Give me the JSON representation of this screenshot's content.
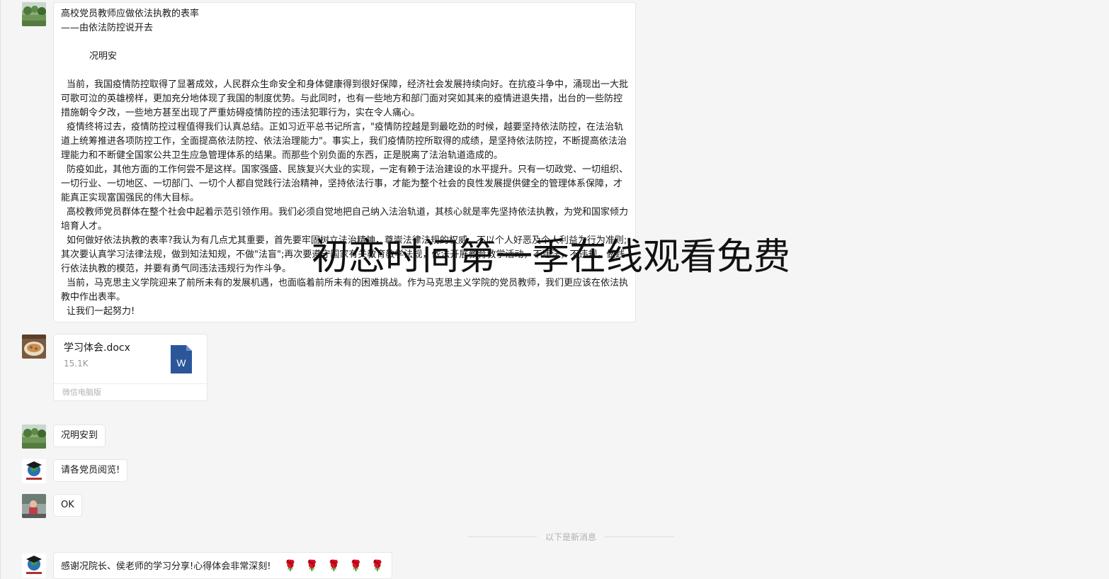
{
  "messages": {
    "article": {
      "title": "高校党员教师应做依法执教的表率",
      "subtitle": "——由依法防控说开去",
      "author": "况明安",
      "paragraphs": [
        "当前，我国疫情防控取得了显著成效，人民群众生命安全和身体健康得到很好保障，经济社会发展持续向好。在抗疫斗争中，涌现出一大批可歌可泣的英雄榜样，更加充分地体现了我国的制度优势。与此同时，也有一些地方和部门面对突如其来的疫情进退失措，出台的一些防控措施朝令夕改，一些地方甚至出现了严重妨碍疫情防控的违法犯罪行为，实在令人痛心。",
        "疫情终将过去，疫情防控过程值得我们认真总结。正如习近平总书记所言，\"疫情防控越是到最吃劲的时候，越要坚持依法防控，在法治轨道上统筹推进各项防控工作，全面提高依法防控、依法治理能力\"。事实上，我们疫情防控所取得的成绩，是坚持依法防控，不断提高依法治理能力和不断健全国家公共卫生应急管理体系的结果。而那些个别负面的东西，正是脱离了法治轨道造成的。",
        "防疫如此，其他方面的工作何尝不是这样。国家强盛、民族复兴大业的实现，一定有赖于法治建设的水平提升。只有一切政党、一切组织、一切行业、一切地区、一切部门、一切个人都自觉践行法治精神，坚持依法行事，才能为整个社会的良性发展提供健全的管理体系保障，才能真正实现富国强民的伟大目标。",
        "高校教师党员群体在整个社会中起着示范引领作用。我们必须自觉地把自己纳入法治轨道，其核心就是率先坚持依法执教，为党和国家倾力培育人才。",
        "如何做好依法执教的表率?我认为有几点尤其重要，首先要牢固树立法治精神，尊崇法律法规的权威，不以个人好恶及个人利益为行为准则;其次要认真学习法律法规，做到知法知规，不做\"法盲\";再次要遵守国家有关教育教学法规，依法开展教育教学活动，不违法，不违规，做践行依法执教的模范，并要有勇气同违法违规行为作斗争。",
        "当前，马克思主义学院迎来了前所未有的发展机遇，也面临着前所未有的困难挑战。作为马克思主义学院的党员教师，我们更应该在依法执教中作出表率。",
        "让我们一起努力!"
      ]
    },
    "file": {
      "name": "学习体会.docx",
      "size": "15.1K",
      "source": "微信电脑版",
      "icon": "word-file-icon",
      "icon_letter": "W",
      "icon_color": "#2b579a"
    },
    "short": [
      {
        "text": "况明安到"
      },
      {
        "text": "请各党员阅览!"
      },
      {
        "text": "OK"
      }
    ],
    "new_divider": "以下是新消息",
    "last": {
      "text": "感谢况院长、侯老师的学习分享!心得体会非常深刻!",
      "emoji": [
        "🌹",
        "🌹",
        "🌹",
        "🌹",
        "🌹"
      ]
    }
  },
  "overlay": {
    "watermark": "初恋时间第一季在线观看免费"
  }
}
